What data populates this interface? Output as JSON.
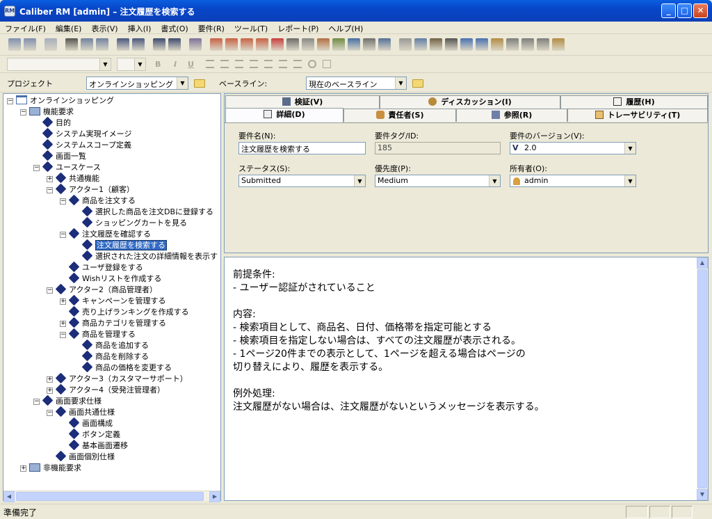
{
  "window": {
    "title": "Caliber RM [admin] – 注文履歴を検索する",
    "app_icon_text": "RM"
  },
  "menu": [
    "ファイル(F)",
    "編集(E)",
    "表示(V)",
    "挿入(I)",
    "書式(O)",
    "要件(R)",
    "ツール(T)",
    "レポート(P)",
    "ヘルプ(H)"
  ],
  "toolbar": {
    "icons": [
      "back-icon",
      "forward-icon",
      "undo-icon",
      "cut-icon",
      "copy-icon",
      "paste-icon",
      "find-icon",
      "find-next-icon",
      "tree-icon",
      "tree-expand-icon",
      "book-icon",
      "add-requirement-icon",
      "add-child-icon",
      "add-sibling-icon",
      "star-icon",
      "delete-icon",
      "save-icon",
      "refresh-icon",
      "pin-icon",
      "link-icon",
      "lock-icon",
      "mail-icon",
      "print-icon",
      "spellcheck-icon",
      "user-icon",
      "library-icon",
      "frame-icon",
      "network-icon",
      "table-icon",
      "users-icon",
      "tag-icon",
      "report-icon",
      "docs-icon",
      "hierarchy-icon"
    ]
  },
  "format_toolbar": {
    "font_combo": "",
    "size_combo": "",
    "bold": "B",
    "italic": "I",
    "underline": "U"
  },
  "project_bar": {
    "project_label": "プロジェクト",
    "project_value": "オンラインショッピング",
    "baseline_label": "ベースライン:",
    "baseline_value": "現在のベースライン"
  },
  "tree": {
    "nodes": [
      {
        "label": "オンラインショッピング",
        "depth": 0,
        "kind": "project",
        "expander": "-"
      },
      {
        "label": "機能要求",
        "depth": 1,
        "kind": "book",
        "expander": "-"
      },
      {
        "label": "目的",
        "depth": 2,
        "kind": "req",
        "expander": ""
      },
      {
        "label": "システム実現イメージ",
        "depth": 2,
        "kind": "req",
        "expander": ""
      },
      {
        "label": "システムスコープ定義",
        "depth": 2,
        "kind": "req",
        "expander": ""
      },
      {
        "label": "画面一覧",
        "depth": 2,
        "kind": "req",
        "expander": ""
      },
      {
        "label": "ユースケース",
        "depth": 2,
        "kind": "req",
        "expander": "-"
      },
      {
        "label": "共通機能",
        "depth": 3,
        "kind": "req",
        "expander": "+"
      },
      {
        "label": "アクター1（顧客）",
        "depth": 3,
        "kind": "req",
        "expander": "-"
      },
      {
        "label": "商品を注文する",
        "depth": 4,
        "kind": "req",
        "expander": "-"
      },
      {
        "label": "選択した商品を注文DBに登録する",
        "depth": 5,
        "kind": "req",
        "expander": ""
      },
      {
        "label": "ショッピングカートを見る",
        "depth": 5,
        "kind": "req",
        "expander": ""
      },
      {
        "label": "注文履歴を確認する",
        "depth": 4,
        "kind": "req",
        "expander": "-"
      },
      {
        "label": "注文履歴を検索する",
        "depth": 5,
        "kind": "req",
        "expander": "",
        "selected": true
      },
      {
        "label": "選択された注文の詳細情報を表示す",
        "depth": 5,
        "kind": "req",
        "expander": ""
      },
      {
        "label": "ユーザ登録をする",
        "depth": 4,
        "kind": "req",
        "expander": ""
      },
      {
        "label": "Wishリストを作成する",
        "depth": 4,
        "kind": "req",
        "expander": ""
      },
      {
        "label": "アクター2（商品管理者）",
        "depth": 3,
        "kind": "req",
        "expander": "-"
      },
      {
        "label": "キャンペーンを管理する",
        "depth": 4,
        "kind": "req",
        "expander": "+"
      },
      {
        "label": "売り上げランキングを作成する",
        "depth": 4,
        "kind": "req",
        "expander": ""
      },
      {
        "label": "商品カテゴリを管理する",
        "depth": 4,
        "kind": "req",
        "expander": "+"
      },
      {
        "label": "商品を管理する",
        "depth": 4,
        "kind": "req",
        "expander": "-"
      },
      {
        "label": "商品を追加する",
        "depth": 5,
        "kind": "req",
        "expander": ""
      },
      {
        "label": "商品を削除する",
        "depth": 5,
        "kind": "req",
        "expander": ""
      },
      {
        "label": "商品の価格を変更する",
        "depth": 5,
        "kind": "req",
        "expander": ""
      },
      {
        "label": "アクター3（カスタマーサポート）",
        "depth": 3,
        "kind": "req",
        "expander": "+"
      },
      {
        "label": "アクター4（受発注管理者）",
        "depth": 3,
        "kind": "req",
        "expander": "+"
      },
      {
        "label": "画面要求仕様",
        "depth": 2,
        "kind": "req",
        "expander": "-"
      },
      {
        "label": "画面共通仕様",
        "depth": 3,
        "kind": "req",
        "expander": "-"
      },
      {
        "label": "画面構成",
        "depth": 4,
        "kind": "req",
        "expander": ""
      },
      {
        "label": "ボタン定義",
        "depth": 4,
        "kind": "req",
        "expander": ""
      },
      {
        "label": "基本画面遷移",
        "depth": 4,
        "kind": "req",
        "expander": ""
      },
      {
        "label": "画面個別仕様",
        "depth": 3,
        "kind": "req",
        "expander": ""
      },
      {
        "label": "非機能要求",
        "depth": 1,
        "kind": "book",
        "expander": "+"
      }
    ]
  },
  "tabs": {
    "row1": [
      "検証(V)",
      "ディスカッション(I)",
      "履歴(H)"
    ],
    "row2": [
      "詳細(D)",
      "責任者(S)",
      "参照(R)",
      "トレーサビリティ(T)"
    ],
    "active": "詳細(D)"
  },
  "details": {
    "name_label": "要件名(N):",
    "name_value": "注文履歴を検索する",
    "tag_label": "要件タグ/ID:",
    "tag_value": "185",
    "version_label": "要件のバージョン(V):",
    "version_value": "2.0",
    "status_label": "ステータス(S):",
    "status_value": "Submitted",
    "priority_label": "優先度(P):",
    "priority_value": "Medium",
    "owner_label": "所有者(O):",
    "owner_value": "admin"
  },
  "description": "前提条件:\n- ユーザー認証がされていること\n\n内容:\n- 検索項目として、商品名、日付、価格帯を指定可能とする\n- 検索項目を指定しない場合は、すべての注文履歴が表示される。\n- 1ページ20件までの表示として、1ページを超える場合はページの\n切り替えにより、履歴を表示する。\n\n例外処理:\n注文履歴がない場合は、注文履歴がないというメッセージを表示する。",
  "status": "準備完了"
}
